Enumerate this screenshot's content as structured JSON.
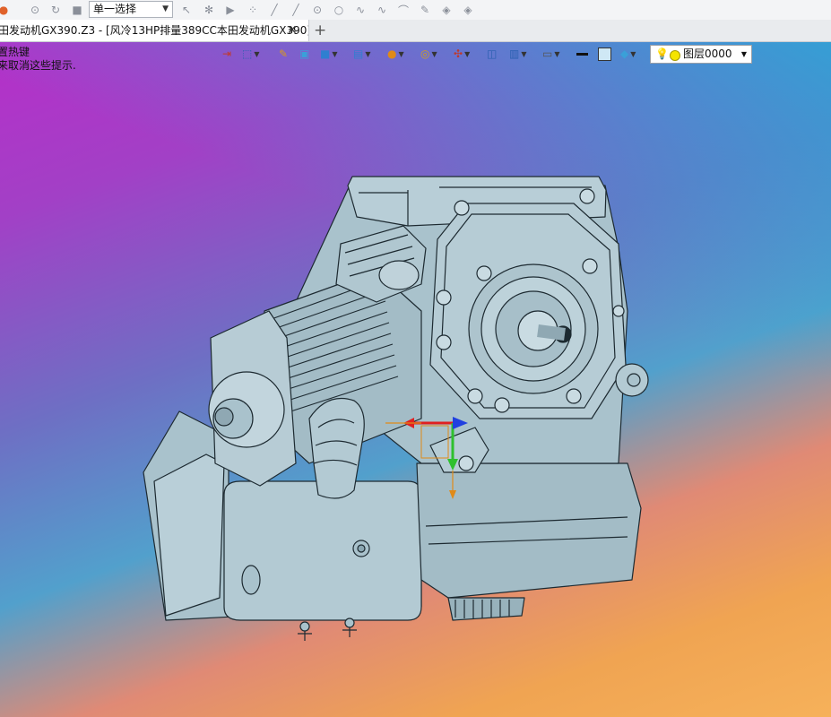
{
  "toolbar": {
    "mode_select_value": "单一选择",
    "icons": [
      "app-logo-icon",
      "rotate-icon",
      "history-icon",
      "stop-icon",
      "cursor-icon",
      "gear-filter-icon",
      "play-icon",
      "point-icon",
      "line-icon",
      "segment-icon",
      "circle-center-icon",
      "circle-icon",
      "curve-icon",
      "spline-icon",
      "arc-icon",
      "pen-icon",
      "layer-icon",
      "stack-icon"
    ]
  },
  "tabs": {
    "active_label": "田发动机GX390.Z3 - [风冷13HP排量389CC本田发动机GX390]",
    "close_glyph": "✕",
    "new_tab_glyph": "+"
  },
  "viewport": {
    "hint_line1": "置热键",
    "hint_line2": "来取消这些提示."
  },
  "view_toolbar": {
    "icons": [
      "exit-icon",
      "select-filter-icon",
      "pencil-icon",
      "shaded-box-icon",
      "cube-view-icon",
      "display-mode-icon",
      "render-sphere-icon",
      "zoom-icon",
      "axis-icon",
      "frame-icon",
      "section-icon",
      "monitor-icon",
      "line-color-icon",
      "fill-color-icon",
      "layer-stack-icon"
    ],
    "layer_value": "图层0000",
    "colors": {
      "line_color": "#111111",
      "fill_color": "#cfe8f5"
    }
  },
  "model": {
    "name": "honda-gx390-engine",
    "body_color": "#a9c2cc",
    "edge_color": "#1d2a31"
  }
}
